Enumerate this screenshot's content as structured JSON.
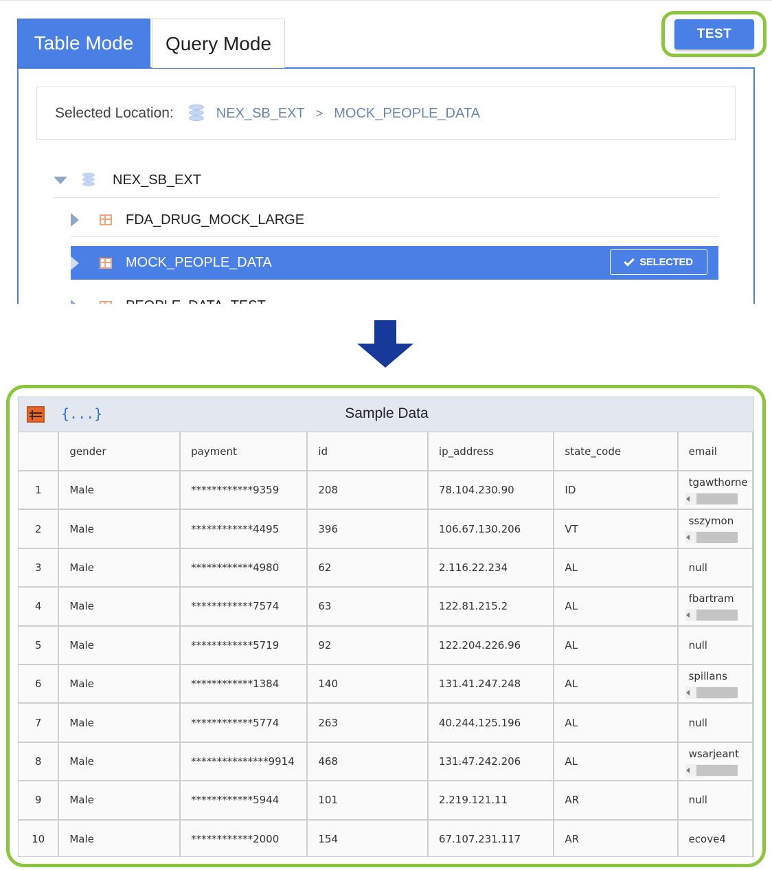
{
  "tabs": {
    "table_mode": "Table Mode",
    "query_mode": "Query Mode"
  },
  "test_button": "TEST",
  "location": {
    "label": "Selected Location:",
    "database": "NEX_SB_EXT",
    "separator": ">",
    "table": "MOCK_PEOPLE_DATA"
  },
  "tree": {
    "root": "NEX_SB_EXT",
    "items": [
      {
        "label": "FDA_DRUG_MOCK_LARGE"
      },
      {
        "label": "MOCK_PEOPLE_DATA",
        "badge": "SELECTED"
      },
      {
        "label": "PEOPLE_DATA_TEST"
      }
    ]
  },
  "sample": {
    "title": "Sample Data",
    "json_icon_text": "{...}",
    "columns": [
      "",
      "gender",
      "payment",
      "id",
      "ip_address",
      "state_code",
      "email"
    ],
    "rows": [
      {
        "n": "1",
        "gender": "Male",
        "payment": "************9359",
        "id": "208",
        "ip": "78.104.230.90",
        "state": "ID",
        "email": "tgawthorne"
      },
      {
        "n": "2",
        "gender": "Male",
        "payment": "************4495",
        "id": "396",
        "ip": "106.67.130.206",
        "state": "VT",
        "email": "sszymon"
      },
      {
        "n": "3",
        "gender": "Male",
        "payment": "************4980",
        "id": "62",
        "ip": "2.116.22.234",
        "state": "AL",
        "email": "null"
      },
      {
        "n": "4",
        "gender": "Male",
        "payment": "************7574",
        "id": "63",
        "ip": "122.81.215.2",
        "state": "AL",
        "email": "fbartram"
      },
      {
        "n": "5",
        "gender": "Male",
        "payment": "************5719",
        "id": "92",
        "ip": "122.204.226.96",
        "state": "AL",
        "email": "null"
      },
      {
        "n": "6",
        "gender": "Male",
        "payment": "************1384",
        "id": "140",
        "ip": "131.41.247.248",
        "state": "AL",
        "email": "spillans"
      },
      {
        "n": "7",
        "gender": "Male",
        "payment": "************5774",
        "id": "263",
        "ip": "40.244.125.196",
        "state": "AL",
        "email": "null"
      },
      {
        "n": "8",
        "gender": "Male",
        "payment": "***************9914",
        "id": "468",
        "ip": "131.47.242.206",
        "state": "AL",
        "email": "wsarjeant"
      },
      {
        "n": "9",
        "gender": "Male",
        "payment": "************5944",
        "id": "101",
        "ip": "2.219.121.11",
        "state": "AR",
        "email": "null"
      },
      {
        "n": "10",
        "gender": "Male",
        "payment": "************2000",
        "id": "154",
        "ip": "67.107.231.117",
        "state": "AR",
        "email": "ecove4"
      }
    ]
  }
}
